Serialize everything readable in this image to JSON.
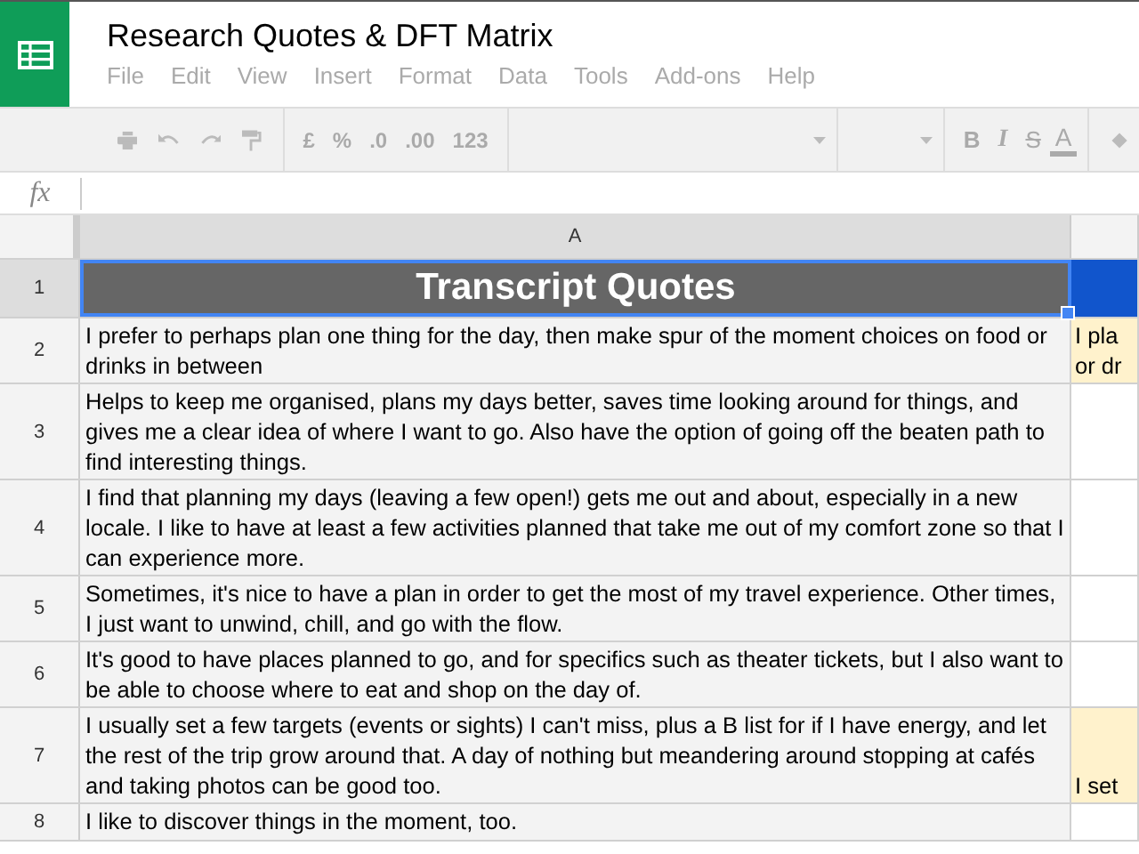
{
  "window": {
    "title": "Research Quotes & DFT Matrix"
  },
  "menu": [
    "File",
    "Edit",
    "View",
    "Insert",
    "Format",
    "Data",
    "Tools",
    "Add-ons",
    "Help"
  ],
  "toolbar": [
    {
      "kind": "print"
    },
    {
      "kind": "undo"
    },
    {
      "kind": "redo"
    },
    {
      "kind": "paint-format"
    },
    {
      "kind": "sep"
    },
    {
      "kind": "text",
      "label": "£"
    },
    {
      "kind": "text",
      "label": "%"
    },
    {
      "kind": "decimal-less",
      "label": ".0"
    },
    {
      "kind": "decimal-more",
      "label": ".00"
    },
    {
      "kind": "dropdown",
      "label": "123"
    },
    {
      "kind": "sep"
    },
    {
      "kind": "select"
    },
    {
      "kind": "sep"
    },
    {
      "kind": "select-small"
    },
    {
      "kind": "sep"
    },
    {
      "kind": "bold",
      "label": "B"
    },
    {
      "kind": "italic",
      "label": "I"
    },
    {
      "kind": "strike",
      "label": "S"
    },
    {
      "kind": "color-text",
      "label": "A"
    },
    {
      "kind": "sep"
    },
    {
      "kind": "fill"
    }
  ],
  "formula_bar": {
    "label": "fx"
  },
  "columns": [
    {
      "label": "A",
      "selected": true
    },
    {
      "selected": false
    }
  ],
  "rows": [
    {
      "number": "1",
      "selected": true,
      "kind": "header",
      "cells": [
        {
          "text": "Transcript Quotes"
        },
        {
          "text": "",
          "color": "#1155cc"
        }
      ]
    },
    {
      "number": "2",
      "selected": false,
      "kind": "text",
      "cells": [
        {
          "text": "I prefer to perhaps plan one thing for the day, then make spur of the moment choices on food or drinks in between"
        },
        {
          "text": "I pla or dr",
          "color": "#fff2cc"
        }
      ]
    },
    {
      "number": "3",
      "selected": false,
      "kind": "text",
      "cells": [
        {
          "text": "Helps to keep me organised, plans my days better, saves time looking around for things, and gives me a clear idea of where I want to go. Also have the option of going off the beaten path to find interesting things."
        },
        {
          "text": ""
        }
      ]
    },
    {
      "number": "4",
      "selected": false,
      "kind": "text",
      "cells": [
        {
          "text": "I find that planning my days (leaving a few open!) gets me out and about, especially in a new locale. I like to have at least a few activities planned that take me out of my comfort zone so that I can experience more."
        },
        {
          "text": ""
        }
      ]
    },
    {
      "number": "5",
      "selected": false,
      "kind": "text",
      "cells": [
        {
          "text": "Sometimes, it's nice to have a plan in order to get the most of my travel experience. Other times, I just want to unwind, chill, and go with the flow."
        },
        {
          "text": ""
        }
      ]
    },
    {
      "number": "6",
      "selected": false,
      "kind": "text",
      "cells": [
        {
          "text": "It's good to have places planned to go, and for specifics such as theater tickets, but I also want to be able to choose where to eat and shop on the day of."
        },
        {
          "text": ""
        }
      ]
    },
    {
      "number": "7",
      "selected": false,
      "kind": "text",
      "cells": [
        {
          "text": "I usually set a few targets (events or sights) I can't miss, plus a B list for if I have energy, and let the rest of the trip grow around that. A day of nothing but meandering around stopping at cafés and taking photos can be good too."
        },
        {
          "text": "I set",
          "color": "#fff2cc"
        }
      ]
    },
    {
      "number": "8",
      "selected": false,
      "kind": "text",
      "cells": [
        {
          "text": "I like to discover things in the moment, too."
        },
        {
          "text": ""
        }
      ]
    }
  ]
}
